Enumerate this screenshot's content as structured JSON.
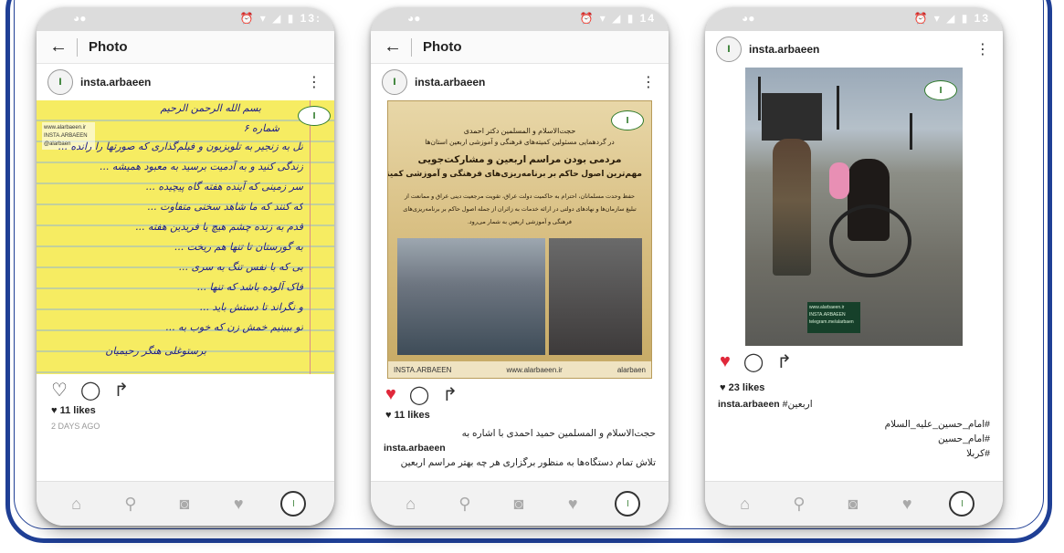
{
  "colors": {
    "frame": "#1f3f95",
    "like_red": "#e0283a",
    "brand_green": "#2f7a2b"
  },
  "phones": [
    {
      "status_left": "",
      "status_right": "13:",
      "topbar_title": "Photo",
      "username": "insta.arbaeen",
      "likes": "11 likes",
      "time_ago": "2 DAYS AGO",
      "liked": false,
      "note": {
        "watermark": [
          "www.alarbaeen.ir",
          "INSTA.ARBAEEN",
          "@alarbaen"
        ],
        "header": "بسم الله الرحمن الرحیم",
        "number": "شماره ۶",
        "lines": [
          "تل به زنجیر به تلویزیون و فیلم‌گذاری که صورتها را رانده ...",
          "زندگی کنید و به آدمیت برسید به معبود همیشه ...",
          "سر زمینی که آینده هفته گاه پیچیده ...",
          "که کنند که ما شاهد سخنی متفاوت ...",
          "قدم به زنده چشم هیچ یا فریدین هفته ...",
          "به گورستان تا تنها هم ریخت ...",
          "بی که با نفس تنگ به سری ...",
          "فاک آلوده باشد که تنها ...",
          "و نگراند تا دستش باید ...",
          "تو ببینیم خمش زن که خوب به ...",
          "برستوغلی هنگر رحیمیان"
        ],
        "signature": "برستوغلی هنگر رحیمیان"
      }
    },
    {
      "status_left": "",
      "status_right": "14",
      "topbar_title": "Photo",
      "username": "insta.arbaeen",
      "likes": "11 likes",
      "liked": true,
      "caption_lines": [
        "حجت‌الاسلام و المسلمین حمید احمدی با اشاره به",
        "insta.arbaeen",
        "تلاش تمام دستگاه‌ها به منظور برگزاری هر چه بهتر مراسم اربعین"
      ],
      "poster": {
        "line1": "حجت‌الاسلام و المسلمین دکتر احمدی",
        "line2": "در گردهمایی مسئولین کمیته‌های فرهنگی و آموزشی اربعین استان‌ها",
        "headline1": "مردمی بودن مراسم اربعین و مشارکت‌جویی",
        "headline2": "مهم‌ترین اصول حاکم بر برنامه‌ریزی‌های فرهنگی و آموزشی کمیته است",
        "body1": "حفظ وحدت مسلمانان، احترام به حاکمیت دولت عراق، تقویت مرجعیت دینی عراق و ممانعت از",
        "body2": "تبلیغ سازمان‌ها و نهادهای دولتی در ارائه خدمات به زائران از جمله اصول حاکم بر برنامه‌ریزی‌های",
        "body3": "فرهنگی و آموزشی اربعین به شمار می‌رود.",
        "footer_left": "INSTA.ARBAEEN",
        "footer_center": "www.alarbaeen.ir",
        "footer_right": "alarbaen"
      }
    },
    {
      "status_left": "",
      "status_right": "13",
      "username": "insta.arbaeen",
      "likes": "23 likes",
      "liked": true,
      "caption_user": "insta.arbaeen",
      "caption_tag": "#اربعین",
      "hashtags": [
        "#امام_حسین_علیه_السلام",
        "#امام_حسین",
        "#کربلا"
      ],
      "banner": [
        "www.alarbaeen.ir",
        "INSTA.ARBAEEN",
        "telegram.me/alarbaen"
      ]
    }
  ]
}
